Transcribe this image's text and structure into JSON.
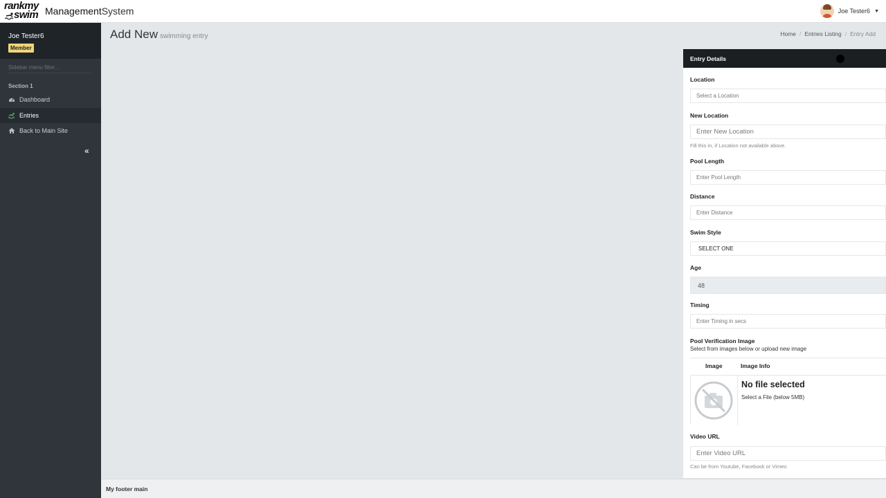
{
  "header": {
    "logo_line1": "rankmy",
    "logo_line2": "swim",
    "title_part1": "Management",
    "title_part2": "System",
    "user_name": "Joe Tester6"
  },
  "sidebar": {
    "user_name": "Joe Tester6",
    "badge": "Member",
    "filter_placeholder": "Sidebar menu filter...",
    "section_title": "Section 1",
    "items": [
      {
        "label": "Dashboard",
        "icon": "dashboard-icon"
      },
      {
        "label": "Entries",
        "icon": "swimmer-icon",
        "active": true
      },
      {
        "label": "Back to Main Site",
        "icon": "home-icon"
      }
    ]
  },
  "main": {
    "title": "Add New",
    "subtitle": "swimming entry",
    "breadcrumb": [
      "Home",
      "Entries Listing",
      "Entry Add"
    ]
  },
  "panel": {
    "title": "Entry Details",
    "location": {
      "label": "Location",
      "placeholder": "Select a Location"
    },
    "new_location": {
      "label": "New Location",
      "placeholder": "Enter New Location",
      "help": "Fill this in, if Location not available above."
    },
    "pool_length": {
      "label": "Pool Length",
      "placeholder": "Enter Pool Length"
    },
    "distance": {
      "label": "Distance",
      "placeholder": "Enter Distance"
    },
    "swim_style": {
      "label": "Swim Style",
      "value": "SELECT ONE"
    },
    "age": {
      "label": "Age",
      "value": "48"
    },
    "timing": {
      "label": "Timing",
      "placeholder": "Enter Timing in secs"
    },
    "pool_image": {
      "label": "Pool Verification Image",
      "help": "Select from images below or upload new image",
      "col_image": "Image",
      "col_info": "Image Info",
      "no_file": "No file selected",
      "select_file": "Select a File (below 5MB)"
    },
    "video_url": {
      "label": "Video URL",
      "placeholder": "Enter Video URL",
      "help": "Can be from Youtube, Facebook or Vimeo"
    }
  },
  "footer": {
    "text": "My footer main"
  },
  "colors": {
    "sidebar_bg": "#2f353a",
    "panel_head_bg": "#1c1f22",
    "badge_bg": "#f0d67a",
    "entries_icon": "#4dbd74"
  }
}
